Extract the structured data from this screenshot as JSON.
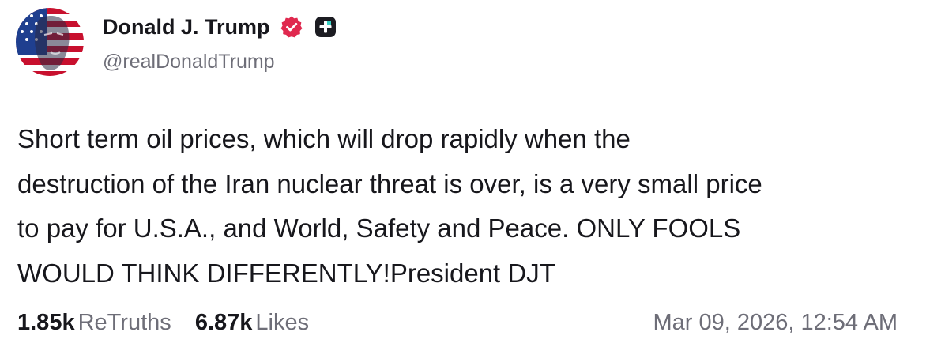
{
  "author": {
    "display_name": "Donald J. Trump",
    "handle": "@realDonaldTrump",
    "avatar_icon": "flag-portrait-avatar",
    "verified_icon": "verified-badge-icon",
    "plus_icon": "plus-badge-icon"
  },
  "post": {
    "text": "Short term oil prices, which will drop rapidly when the\ndestruction of the Iran nuclear threat is over, is a very small price\nto pay for U.S.A., and World, Safety and Peace. ONLY FOOLS\nWOULD THINK DIFFERENTLY!President DJT"
  },
  "stats": {
    "retruths_count": "1.85k",
    "retruths_label": "ReTruths",
    "likes_count": "6.87k",
    "likes_label": "Likes"
  },
  "timestamp": "Mar 09, 2026, 12:54 AM",
  "colors": {
    "text_primary": "#17171c",
    "text_secondary": "#6e6e78",
    "verified_badge": "#e0294f",
    "plus_badge": "#1c1c22"
  }
}
